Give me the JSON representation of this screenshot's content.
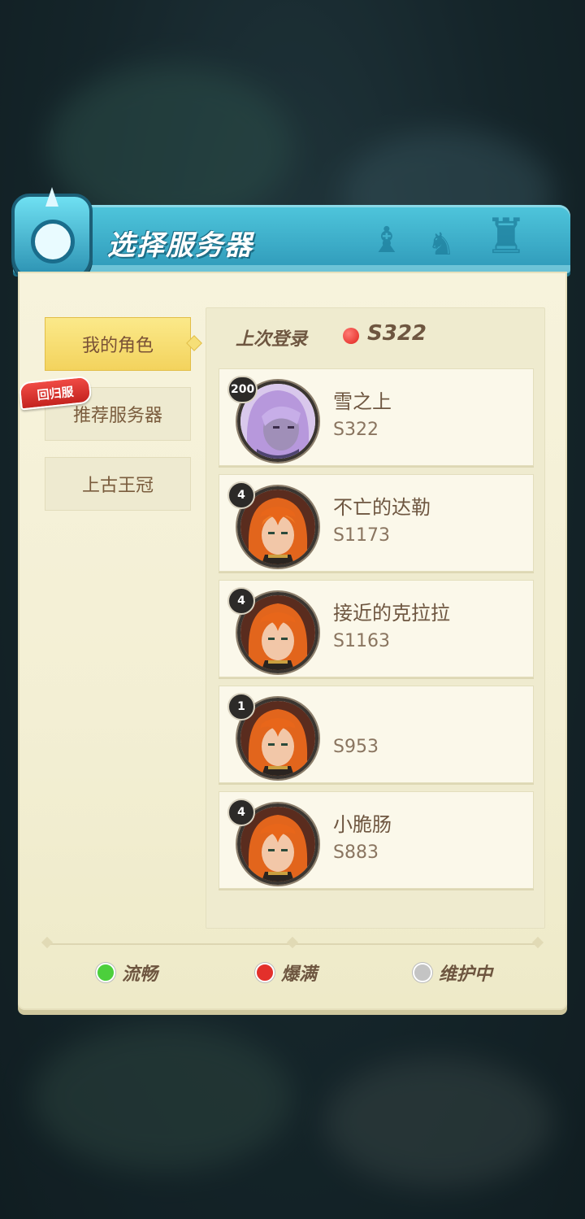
{
  "dialog": {
    "title": "选择服务器"
  },
  "tabs": [
    {
      "label": "我的角色",
      "active": true
    },
    {
      "label": "推荐服务器",
      "badge": "回归服"
    },
    {
      "label": "上古王冠"
    }
  ],
  "last_login": {
    "label": "上次登录",
    "server": "S322",
    "status_color": "#e3302b"
  },
  "characters": [
    {
      "level": "200",
      "name": "雪之上",
      "server": "S322",
      "avatar": "lavender-hair-hero-avatar"
    },
    {
      "level": "4",
      "name": "不亡的达勒",
      "server": "S1173",
      "avatar": "orange-hair-elf-avatar"
    },
    {
      "level": "4",
      "name": "接近的克拉拉",
      "server": "S1163",
      "avatar": "orange-hair-elf-avatar"
    },
    {
      "level": "1",
      "name": "",
      "server": "S953",
      "avatar": "orange-hair-elf-avatar"
    },
    {
      "level": "4",
      "name": "小脆肠",
      "server": "S883",
      "avatar": "orange-hair-elf-avatar"
    }
  ],
  "legend": [
    {
      "label": "流畅",
      "color": "#4ccf3c"
    },
    {
      "label": "爆满",
      "color": "#e3302b"
    },
    {
      "label": "维护中",
      "color": "#c4c4c4"
    }
  ]
}
